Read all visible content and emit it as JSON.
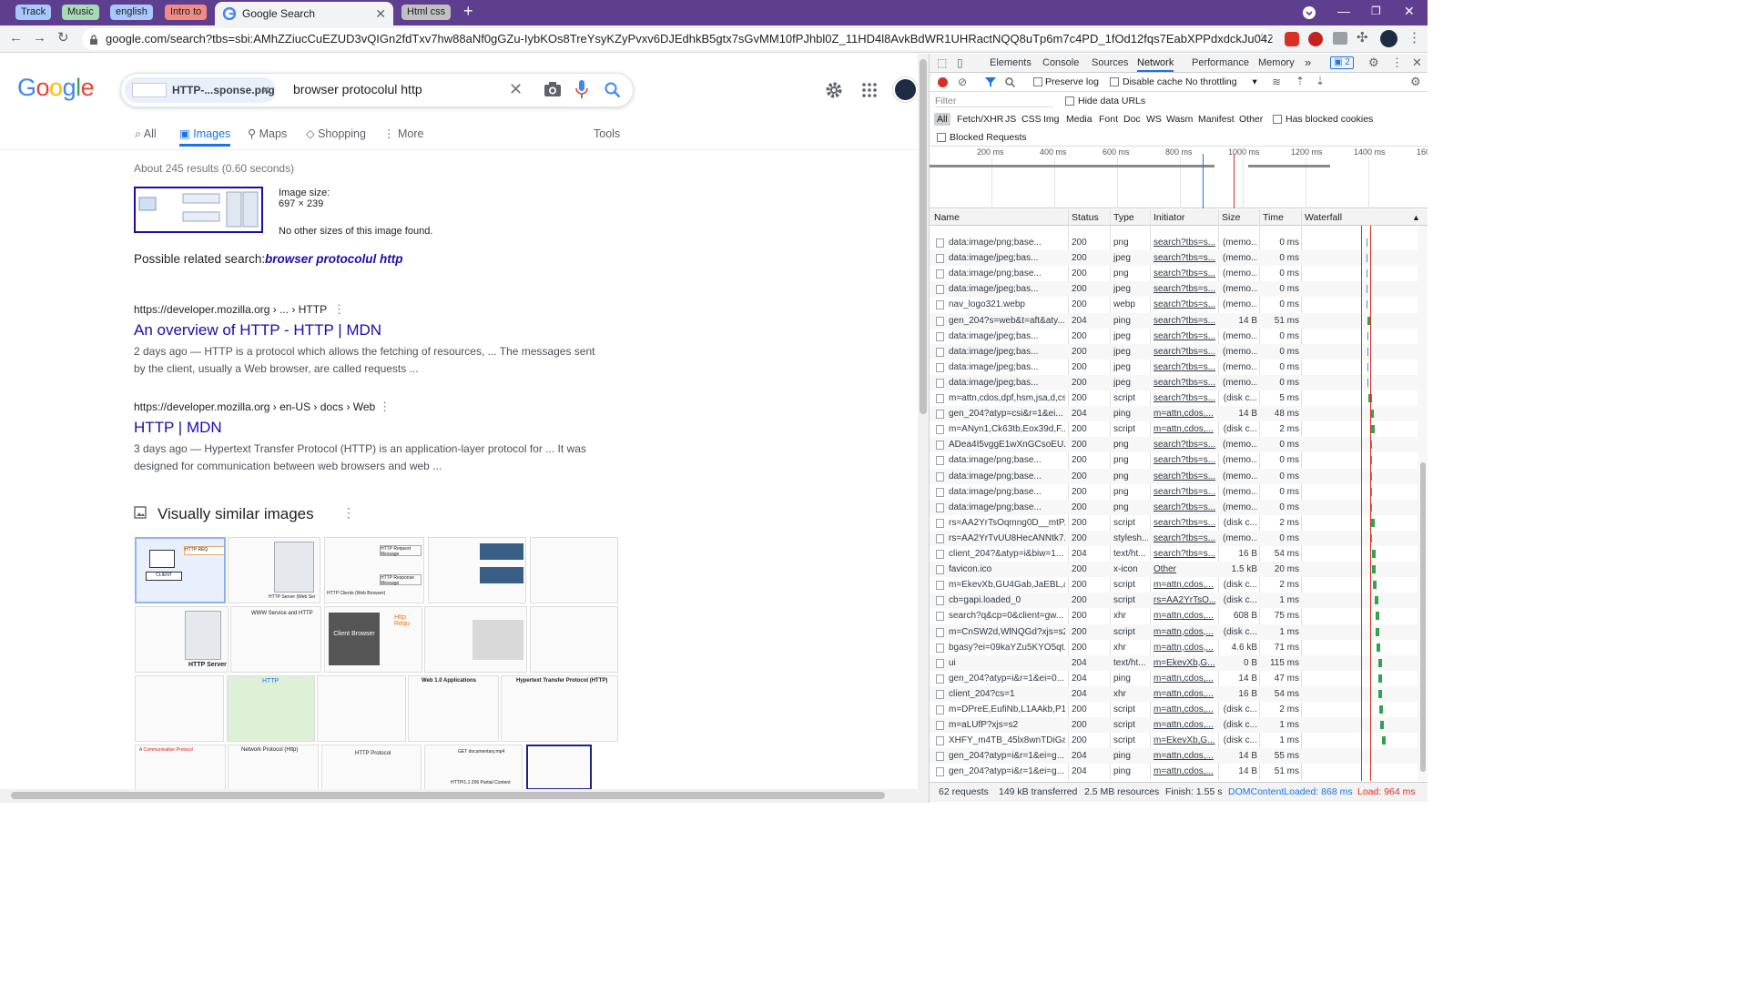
{
  "browser": {
    "tab_groups": [
      {
        "label": "Track",
        "color": "#a8c7fa"
      },
      {
        "label": "Music",
        "color": "#a8dab5"
      },
      {
        "label": "english",
        "color": "#a8c7fa"
      },
      {
        "label": "Intro to",
        "color": "#f28b82"
      },
      {
        "label": "Html css",
        "color": "#c0c0c0"
      }
    ],
    "active_tab": {
      "title": "Google Search"
    },
    "address": "google.com/search?tbs=sbi:AMhZZiucCuEZUD3vQIGn2fdTxv7hw88aNf0gGZu-IybKOs8TreYsyKZyPvxv6DJEdhkB5gtx7sGvMM10fPJhbl0Z_11HD4l8AvkBdWR1UHRactNQQ8uTp6m7c4PD_1fOd12fqs7EabXPPdxdckJu04Z593rcJlatpqA473yBDK4HQMxisKl..."
  },
  "google": {
    "logo": "Google",
    "chip_label": "HTTP-...sponse.png",
    "query": "browser protocolul http",
    "tabs": [
      "All",
      "Images",
      "Maps",
      "Shopping",
      "More"
    ],
    "tools": "Tools",
    "results_stats": "About 245 results (0.60 seconds)",
    "image_size_label": "Image size:",
    "image_size_value": "697 × 239",
    "no_other_sizes": "No other sizes of this image found.",
    "related_prefix": "Possible related search:",
    "related_query": "browser protocolul http",
    "results": [
      {
        "url": "https://developer.mozilla.org › ... › HTTP",
        "title": "An overview of HTTP - HTTP | MDN",
        "snippet_line1": "2 days ago — HTTP is a protocol which allows the fetching of resources, ... The messages sent",
        "snippet_line2": "by the client, usually a Web browser, are called requests ..."
      },
      {
        "url": "https://developer.mozilla.org › en-US › docs › Web",
        "title": "HTTP | MDN",
        "snippet_line1": "3 days ago — Hypertext Transfer Protocol (HTTP) is an application-layer protocol for ... It was",
        "snippet_line2": "designed for communication between web browsers and web ..."
      }
    ],
    "similar_heading": "Visually similar images",
    "thumb_texts": [
      "HTTP REQ",
      "CLIENT",
      "HTTP Server (Web Ser",
      "HTTP Clients (Web Browser)",
      "HTTP Request Message",
      "HTTP Response Message",
      "Client Browser",
      "Http Requ",
      "HTTP Server",
      "WWW Service and HTTP",
      "HTTP",
      "Hypertext Transfer Protocol (HTTP)",
      "Web 1.0 Applications",
      "Network Protocol (Http)",
      "HTTP Protocol",
      "A Communication Protocol",
      "GET documentary.mp4",
      "HTTP/1.1 206 Partial Content"
    ]
  },
  "devtools": {
    "tabs": [
      "Elements",
      "Console",
      "Sources",
      "Network",
      "Performance",
      "Memory"
    ],
    "active_tab": "Network",
    "issues_count": "2",
    "toolbar": {
      "preserve_log": "Preserve log",
      "disable_cache": "Disable cache",
      "throttling": "No throttling"
    },
    "filter_placeholder": "Filter",
    "hide_data_urls": "Hide data URLs",
    "type_filters": [
      "All",
      "Fetch/XHR",
      "JS",
      "CSS",
      "Img",
      "Media",
      "Font",
      "Doc",
      "WS",
      "Wasm",
      "Manifest",
      "Other"
    ],
    "has_blocked_cookies": "Has blocked cookies",
    "blocked_requests": "Blocked Requests",
    "timeline_ticks": [
      "200 ms",
      "400 ms",
      "600 ms",
      "800 ms",
      "1000 ms",
      "1200 ms",
      "1400 ms",
      "1600"
    ],
    "columns": [
      "Name",
      "Status",
      "Type",
      "Initiator",
      "Size",
      "Time",
      "Waterfall"
    ],
    "rows": [
      {
        "name": "data:image/png;base...",
        "status": "200",
        "type": "png",
        "initiator": "search?tbs=s...",
        "size": "(memo...",
        "time": "0 ms",
        "wf": 0.52
      },
      {
        "name": "data:image/jpeg;bas...",
        "status": "200",
        "type": "jpeg",
        "initiator": "search?tbs=s...",
        "size": "(memo...",
        "time": "0 ms",
        "wf": 0.52
      },
      {
        "name": "data:image/png;base...",
        "status": "200",
        "type": "png",
        "initiator": "search?tbs=s...",
        "size": "(memo...",
        "time": "0 ms",
        "wf": 0.52
      },
      {
        "name": "data:image/jpeg;bas...",
        "status": "200",
        "type": "jpeg",
        "initiator": "search?tbs=s...",
        "size": "(memo...",
        "time": "0 ms",
        "wf": 0.52
      },
      {
        "name": "nav_logo321.webp",
        "status": "200",
        "type": "webp",
        "initiator": "search?tbs=s...",
        "size": "(memo...",
        "time": "0 ms",
        "wf": 0.52
      },
      {
        "name": "gen_204?s=web&t=aft&aty...",
        "status": "204",
        "type": "ping",
        "initiator": "search?tbs=s...",
        "size": "14 B",
        "time": "51 ms",
        "wf": 0.53
      },
      {
        "name": "data:image/jpeg;bas...",
        "status": "200",
        "type": "jpeg",
        "initiator": "search?tbs=s...",
        "size": "(memo...",
        "time": "0 ms",
        "wf": 0.53
      },
      {
        "name": "data:image/jpeg;bas...",
        "status": "200",
        "type": "jpeg",
        "initiator": "search?tbs=s...",
        "size": "(memo...",
        "time": "0 ms",
        "wf": 0.53
      },
      {
        "name": "data:image/jpeg;bas...",
        "status": "200",
        "type": "jpeg",
        "initiator": "search?tbs=s...",
        "size": "(memo...",
        "time": "0 ms",
        "wf": 0.53
      },
      {
        "name": "data:image/jpeg;bas...",
        "status": "200",
        "type": "jpeg",
        "initiator": "search?tbs=s...",
        "size": "(memo...",
        "time": "0 ms",
        "wf": 0.53
      },
      {
        "name": "m=attn,cdos,dpf,hsm,jsa,d,csi",
        "status": "200",
        "type": "script",
        "initiator": "search?tbs=s...",
        "size": "(disk c...",
        "time": "5 ms",
        "wf": 0.54
      },
      {
        "name": "gen_204?atyp=csi&r=1&ei...",
        "status": "204",
        "type": "ping",
        "initiator": "m=attn,cdos,...",
        "size": "14 B",
        "time": "48 ms",
        "wf": 0.55
      },
      {
        "name": "m=ANyn1,Ck63tb,Eox39d,F...",
        "status": "200",
        "type": "script",
        "initiator": "m=attn,cdos,...",
        "size": "(disk c...",
        "time": "2 ms",
        "wf": 0.56
      },
      {
        "name": "ADea4I5vggE1wXnGCsoEU...",
        "status": "200",
        "type": "png",
        "initiator": "search?tbs=s...",
        "size": "(memo...",
        "time": "0 ms",
        "wf": 0.56
      },
      {
        "name": "data:image/png;base...",
        "status": "200",
        "type": "png",
        "initiator": "search?tbs=s...",
        "size": "(memo...",
        "time": "0 ms",
        "wf": 0.56
      },
      {
        "name": "data:image/png;base...",
        "status": "200",
        "type": "png",
        "initiator": "search?tbs=s...",
        "size": "(memo...",
        "time": "0 ms",
        "wf": 0.56
      },
      {
        "name": "data:image/png;base...",
        "status": "200",
        "type": "png",
        "initiator": "search?tbs=s...",
        "size": "(memo...",
        "time": "0 ms",
        "wf": 0.56
      },
      {
        "name": "data:image/png;base...",
        "status": "200",
        "type": "png",
        "initiator": "search?tbs=s...",
        "size": "(memo...",
        "time": "0 ms",
        "wf": 0.56
      },
      {
        "name": "rs=AA2YrTsOqmng0D__mtP...",
        "status": "200",
        "type": "script",
        "initiator": "search?tbs=s...",
        "size": "(disk c...",
        "time": "2 ms",
        "wf": 0.56
      },
      {
        "name": "rs=AA2YrTvUU8HecANNtk7...",
        "status": "200",
        "type": "stylesh...",
        "initiator": "search?tbs=s...",
        "size": "(memo...",
        "time": "0 ms",
        "wf": 0.56
      },
      {
        "name": "client_204?&atyp=i&biw=1...",
        "status": "204",
        "type": "text/ht...",
        "initiator": "search?tbs=s...",
        "size": "16 B",
        "time": "54 ms",
        "wf": 0.57
      },
      {
        "name": "favicon.ico",
        "status": "200",
        "type": "x-icon",
        "initiator": "Other",
        "size": "1.5 kB",
        "time": "20 ms",
        "wf": 0.57
      },
      {
        "name": "m=EkevXb,GU4Gab,JaEBL,a...",
        "status": "200",
        "type": "script",
        "initiator": "m=attn,cdos,...",
        "size": "(disk c...",
        "time": "2 ms",
        "wf": 0.58
      },
      {
        "name": "cb=gapi.loaded_0",
        "status": "200",
        "type": "script",
        "initiator": "rs=AA2YrTsO...",
        "size": "(disk c...",
        "time": "1 ms",
        "wf": 0.59
      },
      {
        "name": "search?q&cp=0&client=gw...",
        "status": "200",
        "type": "xhr",
        "initiator": "m=attn,cdos,...",
        "size": "608 B",
        "time": "75 ms",
        "wf": 0.6
      },
      {
        "name": "m=CnSW2d,WlNQGd?xjs=s2",
        "status": "200",
        "type": "script",
        "initiator": "m=attn,cdos,...",
        "size": "(disk c...",
        "time": "1 ms",
        "wf": 0.6
      },
      {
        "name": "bgasy?ei=09kaYZu5KYO5qt...",
        "status": "200",
        "type": "xhr",
        "initiator": "m=attn,cdos,...",
        "size": "4.6 kB",
        "time": "71 ms",
        "wf": 0.61
      },
      {
        "name": "ui",
        "status": "204",
        "type": "text/ht...",
        "initiator": "m=EkevXb,G...",
        "size": "0 B",
        "time": "115 ms",
        "wf": 0.62
      },
      {
        "name": "gen_204?atyp=i&r=1&ei=0...",
        "status": "204",
        "type": "ping",
        "initiator": "m=attn,cdos,...",
        "size": "14 B",
        "time": "47 ms",
        "wf": 0.62
      },
      {
        "name": "client_204?cs=1",
        "status": "204",
        "type": "xhr",
        "initiator": "m=attn,cdos,...",
        "size": "16 B",
        "time": "54 ms",
        "wf": 0.62
      },
      {
        "name": "m=DPreE,EufiNb,L1AAkb,P1...",
        "status": "200",
        "type": "script",
        "initiator": "m=attn,cdos,...",
        "size": "(disk c...",
        "time": "2 ms",
        "wf": 0.63
      },
      {
        "name": "m=aLUfP?xjs=s2",
        "status": "200",
        "type": "script",
        "initiator": "m=attn,cdos,...",
        "size": "(disk c...",
        "time": "1 ms",
        "wf": 0.64
      },
      {
        "name": "XHFY_m4TB_45lx8wnTDiGa...",
        "status": "200",
        "type": "script",
        "initiator": "m=EkevXb,G...",
        "size": "(disk c...",
        "time": "1 ms",
        "wf": 0.65
      },
      {
        "name": "gen_204?atyp=i&r=1&ei=g...",
        "status": "204",
        "type": "ping",
        "initiator": "m=attn,cdos,...",
        "size": "14 B",
        "time": "55 ms",
        "wf": 0.96
      },
      {
        "name": "gen_204?atyp=i&r=1&ei=g...",
        "status": "204",
        "type": "ping",
        "initiator": "m=attn,cdos,...",
        "size": "14 B",
        "time": "51 ms",
        "wf": 0.96
      }
    ],
    "status": {
      "requests": "62 requests",
      "transferred": "149 kB transferred",
      "resources": "2.5 MB resources",
      "finish": "Finish: 1.55 s",
      "dcl": "DOMContentLoaded: 868 ms",
      "load": "Load: 964 ms"
    }
  }
}
